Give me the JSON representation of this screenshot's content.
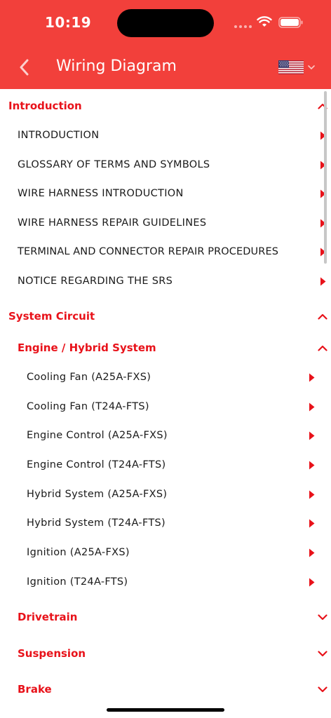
{
  "status_bar": {
    "time": "10:19",
    "icons": [
      "signal-dots-icon",
      "wifi-icon",
      "battery-icon"
    ]
  },
  "header": {
    "title": "Wiring Diagram",
    "back_icon": "chevron-left-icon",
    "language_icon": "us-flag-icon",
    "dropdown_icon": "chevron-down-icon"
  },
  "sections": {
    "introduction": {
      "label": "Introduction",
      "expanded": true,
      "items": [
        "INTRODUCTION",
        "GLOSSARY OF TERMS AND SYMBOLS",
        "WIRE HARNESS INTRODUCTION",
        "WIRE HARNESS REPAIR GUIDELINES",
        "TERMINAL AND CONNECTOR REPAIR PROCEDURES",
        "NOTICE REGARDING THE SRS"
      ]
    },
    "system_circuit": {
      "label": "System Circuit",
      "expanded": true,
      "subsections": {
        "engine_hybrid": {
          "label": "Engine / Hybrid System",
          "expanded": true,
          "items": [
            "Cooling Fan (A25A-FXS)",
            "Cooling Fan (T24A-FTS)",
            "Engine Control (A25A-FXS)",
            "Engine Control (T24A-FTS)",
            "Hybrid System (A25A-FXS)",
            "Hybrid System (T24A-FTS)",
            "Ignition (A25A-FXS)",
            "Ignition (T24A-FTS)"
          ]
        },
        "drivetrain": {
          "label": "Drivetrain",
          "expanded": false
        },
        "suspension": {
          "label": "Suspension",
          "expanded": false
        },
        "brake": {
          "label": "Brake",
          "expanded": false
        }
      }
    }
  },
  "colors": {
    "header_bg": "#f2403b",
    "accent": "#e8121a",
    "text": "#1a1a1a",
    "chevron": "#e8121a"
  }
}
